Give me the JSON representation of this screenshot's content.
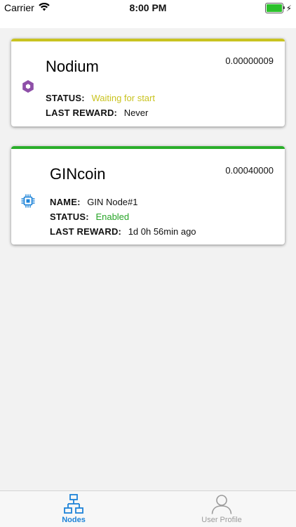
{
  "status_bar": {
    "carrier": "Carrier",
    "time": "8:00 PM",
    "icons": [
      "wifi-icon",
      "battery-icon",
      "charging-bolt-icon"
    ]
  },
  "colors": {
    "nodium_bar": "#c9c320",
    "gincoin_bar": "#2aae2a",
    "status_waiting": "#c9c320",
    "status_enabled": "#27a427",
    "tab_active": "#1d83d8",
    "tab_inactive": "#9b9b9b"
  },
  "cards": [
    {
      "title": "Nodium",
      "amount": "0.00000009",
      "icon": "hexagon-coin-icon",
      "status_label": "STATUS:",
      "status_value": "Waiting for start",
      "last_reward_label": "LAST REWARD:",
      "last_reward_value": "Never"
    },
    {
      "title": "GINcoin",
      "amount": "0.00040000",
      "icon": "chip-coin-icon",
      "name_label": "NAME:",
      "name_value": "GIN Node#1",
      "status_label": "STATUS:",
      "status_value": "Enabled",
      "last_reward_label": "LAST REWARD:",
      "last_reward_value": "1d 0h 56min ago"
    }
  ],
  "tabs": [
    {
      "label": "Nodes",
      "icon": "network-icon",
      "active": true
    },
    {
      "label": "User Profile",
      "icon": "user-icon",
      "active": false
    }
  ]
}
